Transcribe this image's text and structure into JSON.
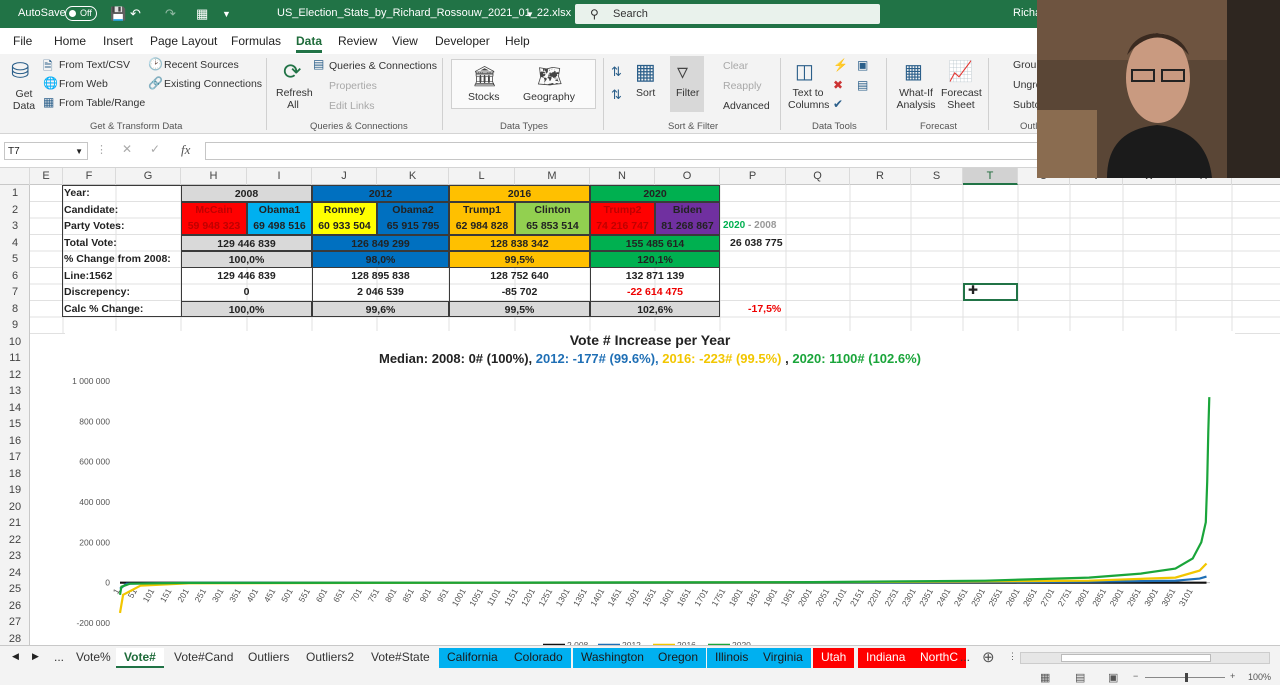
{
  "window": {
    "autosave_label": "AutoSave",
    "autosave_state": "Off",
    "filename": "US_Election_Stats_by_Richard_Rossouw_2021_01_22.xlsx",
    "search_placeholder": "Search",
    "user": "Richa"
  },
  "tabs": [
    "File",
    "Home",
    "Insert",
    "Page Layout",
    "Formulas",
    "Data",
    "Review",
    "View",
    "Developer",
    "Help"
  ],
  "active_tab": "Data",
  "ribbon": {
    "get_data": "Get Data",
    "from_text_csv": "From Text/CSV",
    "from_web": "From Web",
    "from_table_range": "From Table/Range",
    "recent_sources": "Recent Sources",
    "existing_connections": "Existing Connections",
    "group_get_transform": "Get & Transform Data",
    "refresh_all": "Refresh All",
    "queries_connections": "Queries & Connections",
    "properties": "Properties",
    "edit_links": "Edit Links",
    "group_queries": "Queries & Connections",
    "stocks": "Stocks",
    "geography": "Geography",
    "group_data_types": "Data Types",
    "sort": "Sort",
    "filter": "Filter",
    "clear": "Clear",
    "reapply": "Reapply",
    "advanced": "Advanced",
    "group_sort_filter": "Sort & Filter",
    "text_to_columns": "Text to Columns",
    "group_data_tools": "Data Tools",
    "what_if": "What-If Analysis",
    "forecast_sheet": "Forecast Sheet",
    "group_forecast": "Forecast",
    "group_btn": "Group",
    "ungroup_btn": "Ungro",
    "subtotal_btn": "Subto",
    "group_outline": "Outl"
  },
  "formula_bar": {
    "name_box": "T7",
    "fx": "fx",
    "content": ""
  },
  "columns": [
    "E",
    "F",
    "G",
    "H",
    "I",
    "J",
    "K",
    "L",
    "M",
    "N",
    "O",
    "P",
    "Q",
    "R",
    "S",
    "T",
    "U",
    "V",
    "W",
    "X"
  ],
  "selected_column": "T",
  "rows": [
    "1",
    "2",
    "3",
    "4",
    "5",
    "6",
    "7",
    "8",
    "9",
    "10",
    "11",
    "12",
    "13",
    "14",
    "15",
    "16",
    "17",
    "18",
    "19",
    "20",
    "21",
    "22",
    "23",
    "24",
    "25",
    "26",
    "27",
    "28",
    "29"
  ],
  "table": {
    "labels": [
      "Year:",
      "Candidate:",
      "Party Votes:",
      "Total Vote:",
      "% Change from 2008:",
      "Line:1562",
      "Discrepency:",
      "Calc % Change:"
    ],
    "years": [
      "2008",
      "2012",
      "2016",
      "2020"
    ],
    "candidates": [
      "McCain",
      "Obama1",
      "Romney",
      "Obama2",
      "Trump1",
      "Clinton",
      "Trump2",
      "Biden"
    ],
    "party_votes": [
      "59 948 323",
      "69 498 516",
      "60 933 504",
      "65 915 795",
      "62 984 828",
      "65 853 514",
      "74 216 747",
      "81 268 867"
    ],
    "total_vote": [
      "129 446 839",
      "126 849 299",
      "128 838 342",
      "155 485 614"
    ],
    "pct_change_2008": [
      "100,0%",
      "98,0%",
      "99,5%",
      "120,1%"
    ],
    "line_1562": [
      "129 446 839",
      "128 895 838",
      "128 752 640",
      "132 871 139"
    ],
    "discrepancy": [
      "0",
      "2 046 539",
      "-85 702",
      "-22 614 475"
    ],
    "calc_pct_change": [
      "100,0%",
      "99,6%",
      "99,5%",
      "102,6%"
    ],
    "diff_label_a": "2020",
    "diff_label_sep": " - ",
    "diff_label_b": "2008",
    "diff_value": "26 038 775",
    "calc_side_value": "-17,5%"
  },
  "chart_data": {
    "type": "line",
    "title": "Vote # Increase per Year",
    "subtitle_parts": [
      {
        "text": "Median: 2008: 0# (100%), ",
        "color": "#222222"
      },
      {
        "text": "2012: -177# (99.6%), ",
        "color": "#1f6fb5"
      },
      {
        "text": "2016: -223# (99.5%) ",
        "color": "#f2c600"
      },
      {
        "text": ", ",
        "color": "#222222"
      },
      {
        "text": "2020: 1100# (102.6%)",
        "color": "#1aa53a"
      }
    ],
    "ylim": [
      -200000,
      1000000
    ],
    "y_ticks": [
      "1 000 000",
      "800 000",
      "600 000",
      "400 000",
      "200 000",
      "0",
      "-200 000"
    ],
    "y_tick_values": [
      1000000,
      800000,
      600000,
      400000,
      200000,
      0,
      -200000
    ],
    "xlim": [
      1,
      3150
    ],
    "x_ticks": [
      "1",
      "51",
      "101",
      "151",
      "201",
      "251",
      "301",
      "351",
      "401",
      "451",
      "501",
      "551",
      "601",
      "651",
      "701",
      "751",
      "801",
      "851",
      "901",
      "951",
      "1001",
      "1051",
      "1101",
      "1151",
      "1201",
      "1251",
      "1301",
      "1351",
      "1401",
      "1451",
      "1501",
      "1551",
      "1601",
      "1651",
      "1701",
      "1751",
      "1801",
      "1851",
      "1901",
      "1951",
      "2001",
      "2051",
      "2101",
      "2151",
      "2201",
      "2251",
      "2301",
      "2351",
      "2401",
      "2451",
      "2501",
      "2551",
      "2601",
      "2651",
      "2701",
      "2751",
      "2801",
      "2851",
      "2901",
      "2951",
      "3001",
      "3051",
      "3101"
    ],
    "series": [
      {
        "name": "2 008",
        "color": "#111111",
        "x": [
          1,
          20,
          200,
          1000,
          2000,
          2800,
          3050,
          3120,
          3140
        ],
        "y": [
          0,
          0,
          0,
          0,
          0,
          0,
          0,
          0,
          0
        ]
      },
      {
        "name": "2012",
        "color": "#1f6fb5",
        "x": [
          1,
          20,
          200,
          1000,
          2000,
          2800,
          3050,
          3120,
          3140
        ],
        "y": [
          -30000,
          -5000,
          -1000,
          -200,
          0,
          5000,
          10000,
          20000,
          30000
        ]
      },
      {
        "name": "2016",
        "color": "#f2c600",
        "x": [
          1,
          10,
          60,
          200,
          1000,
          2000,
          2800,
          3050,
          3120,
          3140
        ],
        "y": [
          -150000,
          -60000,
          -15000,
          -3000,
          -200,
          2000,
          10000,
          25000,
          60000,
          95000
        ]
      },
      {
        "name": "2020",
        "color": "#1aa53a",
        "x": [
          1,
          5,
          30,
          200,
          1000,
          2000,
          2500,
          2800,
          2950,
          3050,
          3100,
          3125,
          3138,
          3142,
          3145,
          3148
        ],
        "y": [
          -60000,
          -20000,
          -5000,
          -1000,
          0,
          3000,
          10000,
          25000,
          45000,
          70000,
          120000,
          200000,
          300000,
          500000,
          750000,
          920000
        ]
      }
    ],
    "legend_position": "bottom"
  },
  "sheet_tabs": [
    {
      "label": "...",
      "color": ""
    },
    {
      "label": "Vote%",
      "color": ""
    },
    {
      "label": "Vote#",
      "color": "",
      "active": true
    },
    {
      "label": "Vote#Cand",
      "color": ""
    },
    {
      "label": "Outliers",
      "color": ""
    },
    {
      "label": "Outliers2",
      "color": ""
    },
    {
      "label": "Vote#State",
      "color": ""
    },
    {
      "label": "California",
      "color": "#00b0f0"
    },
    {
      "label": "Colorado",
      "color": "#00b0f0"
    },
    {
      "label": "Washington",
      "color": "#00b0f0"
    },
    {
      "label": "Oregon",
      "color": "#00b0f0"
    },
    {
      "label": "Illinois",
      "color": "#00b0f0"
    },
    {
      "label": "Virginia",
      "color": "#00b0f0"
    },
    {
      "label": "Utah",
      "color": "#ff0000"
    },
    {
      "label": "Indiana",
      "color": "#ff0000"
    },
    {
      "label": "NorthC",
      "color": "#ff0000"
    },
    {
      "label": "...",
      "color": ""
    }
  ],
  "status": {
    "zoom": "100%"
  },
  "colors": {
    "excel_green": "#217346",
    "gray_cell": "#d9d9d9",
    "blue_cell": "#0070c0",
    "yellow_cell": "#ffc000",
    "green_cell": "#00b050",
    "red_cell": "#ff0000",
    "cyan_cell": "#00b0f0",
    "lime_cell": "#92d050",
    "purple_cell": "#7030a0"
  }
}
